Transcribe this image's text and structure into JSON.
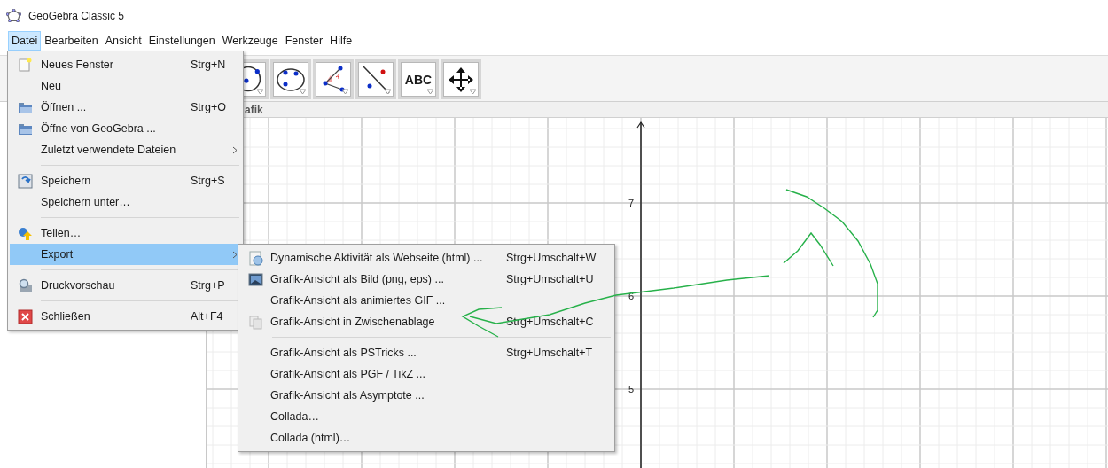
{
  "window": {
    "title": "GeoGebra Classic 5"
  },
  "menu_bar": [
    {
      "label": "Datei",
      "selected": true
    },
    {
      "label": "Bearbeiten",
      "selected": false
    },
    {
      "label": "Ansicht",
      "selected": false
    },
    {
      "label": "Einstellungen",
      "selected": false
    },
    {
      "label": "Werkzeuge",
      "selected": false
    },
    {
      "label": "Fenster",
      "selected": false
    },
    {
      "label": "Hilfe",
      "selected": false
    }
  ],
  "file_menu": [
    {
      "kind": "item",
      "label": "Neues Fenster",
      "shortcut": "Strg+N",
      "submenu": false,
      "selected": false
    },
    {
      "kind": "item",
      "label": "Neu",
      "submenu": false,
      "selected": false
    },
    {
      "kind": "item",
      "label": "Öffnen ...",
      "shortcut": "Strg+O",
      "submenu": false,
      "selected": false
    },
    {
      "kind": "item",
      "label": "Öffne von GeoGebra ...",
      "submenu": false,
      "selected": false
    },
    {
      "kind": "item",
      "label": "Zuletzt verwendete Dateien",
      "submenu": true,
      "selected": false
    },
    {
      "kind": "separator"
    },
    {
      "kind": "item",
      "label": "Speichern",
      "shortcut": "Strg+S",
      "submenu": false,
      "selected": false
    },
    {
      "kind": "item",
      "label": "Speichern unter…",
      "submenu": false,
      "selected": false
    },
    {
      "kind": "separator"
    },
    {
      "kind": "item",
      "label": "Teilen…",
      "submenu": false,
      "selected": false
    },
    {
      "kind": "item",
      "label": "Export",
      "submenu": true,
      "selected": true
    },
    {
      "kind": "separator"
    },
    {
      "kind": "item",
      "label": "Druckvorschau",
      "shortcut": "Strg+P",
      "submenu": false,
      "selected": false
    },
    {
      "kind": "separator"
    },
    {
      "kind": "item",
      "label": "Schließen",
      "shortcut": "Alt+F4",
      "submenu": false,
      "selected": false
    }
  ],
  "export_menu": [
    {
      "kind": "item",
      "label": "Dynamische Aktivität als Webseite (html) ...",
      "shortcut": "Strg+Umschalt+W",
      "selected": false
    },
    {
      "kind": "item",
      "label": "Grafik-Ansicht als Bild (png, eps) ...",
      "shortcut": "Strg+Umschalt+U",
      "selected": false
    },
    {
      "kind": "item",
      "label": "Grafik-Ansicht als animiertes GIF ...",
      "selected": false
    },
    {
      "kind": "item",
      "label": "Grafik-Ansicht in Zwischenablage",
      "shortcut": "Strg+Umschalt+C",
      "selected": false
    },
    {
      "kind": "separator"
    },
    {
      "kind": "item",
      "label": "Grafik-Ansicht als PSTricks ...",
      "shortcut": "Strg+Umschalt+T",
      "selected": false
    },
    {
      "kind": "item",
      "label": "Grafik-Ansicht als PGF / TikZ ...",
      "selected": false
    },
    {
      "kind": "item",
      "label": "Grafik-Ansicht als Asymptote ...",
      "selected": false
    },
    {
      "kind": "item",
      "label": "Collada…",
      "selected": false
    },
    {
      "kind": "item",
      "label": "Collada (html)…",
      "selected": false
    }
  ],
  "toolbar": {
    "text_tool_label": "ABC"
  },
  "graphics_view": {
    "header": "afik",
    "y_axis_labels": [
      "7",
      "6",
      "5"
    ]
  }
}
